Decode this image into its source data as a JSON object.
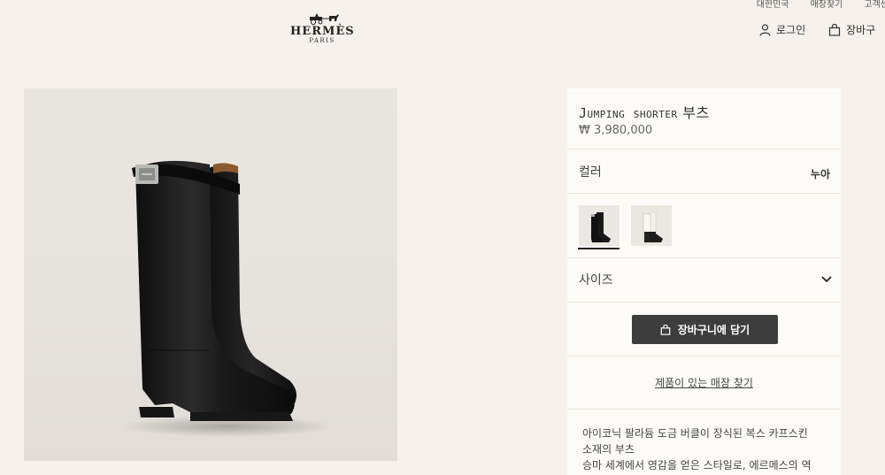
{
  "header": {
    "brand": "HERMÈS",
    "brand_sub": "PARIS",
    "util_links": [
      "대한민국",
      "매장찾기",
      "고객센"
    ],
    "login_label": "로그인",
    "cart_label": "장바구"
  },
  "product": {
    "title_latin": "Jumping shorter",
    "title_korean": "부츠",
    "price": "₩ 3,980,000",
    "color_label": "컬러",
    "color_value": "누아",
    "size_label": "사이즈",
    "add_to_cart_label": "장바구니에 담기",
    "store_link_label": "제품이 있는 매장 찾기",
    "description_lines": [
      "아이코닉 팔라듐 도금 버클이 장식된 복스 카프스킨",
      "소재의 부츠",
      "승마 세계에서 영감을 얻은 스타일로, 에르메스의 역"
    ]
  },
  "icons": [
    "carriage-logo-icon",
    "user-icon",
    "bag-icon",
    "chevron-down-icon"
  ],
  "colors": {
    "background": "#f6f1eb",
    "panel": "#fcfbf8",
    "button": "#3d3d3d",
    "boot": "#1a1a1a"
  }
}
